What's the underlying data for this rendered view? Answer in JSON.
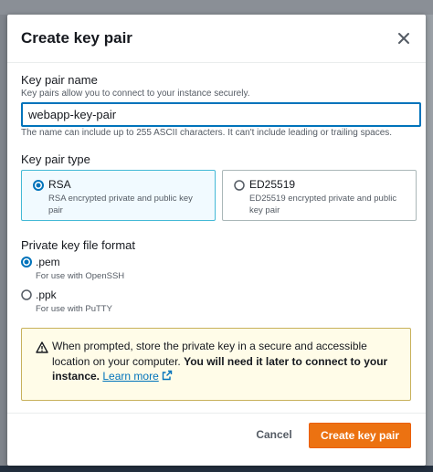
{
  "modal": {
    "title": "Create key pair"
  },
  "key_name": {
    "label": "Key pair name",
    "description": "Key pairs allow you to connect to your instance securely.",
    "value": "webapp-key-pair",
    "constraint": "The name can include up to 255 ASCII characters. It can't include leading or trailing spaces."
  },
  "key_type": {
    "label": "Key pair type",
    "options": [
      {
        "title": "RSA",
        "description": "RSA encrypted private and public key pair",
        "selected": true
      },
      {
        "title": "ED25519",
        "description": "ED25519 encrypted private and public key pair",
        "selected": false
      }
    ]
  },
  "file_format": {
    "label": "Private key file format",
    "options": [
      {
        "title": ".pem",
        "description": "For use with OpenSSH",
        "selected": true
      },
      {
        "title": ".ppk",
        "description": "For use with PuTTY",
        "selected": false
      }
    ]
  },
  "alert": {
    "icon": "warning-icon",
    "text_start": "When prompted, store the private key in a secure and accessible location on your computer.",
    "text_bold": "You will need it later to connect to your instance.",
    "link_text": "Learn more"
  },
  "footer": {
    "cancel_label": "Cancel",
    "create_label": "Create key pair"
  },
  "colors": {
    "accent": "#0073bb",
    "primary_button": "#ec7211",
    "warning_bg": "#fffce8"
  }
}
